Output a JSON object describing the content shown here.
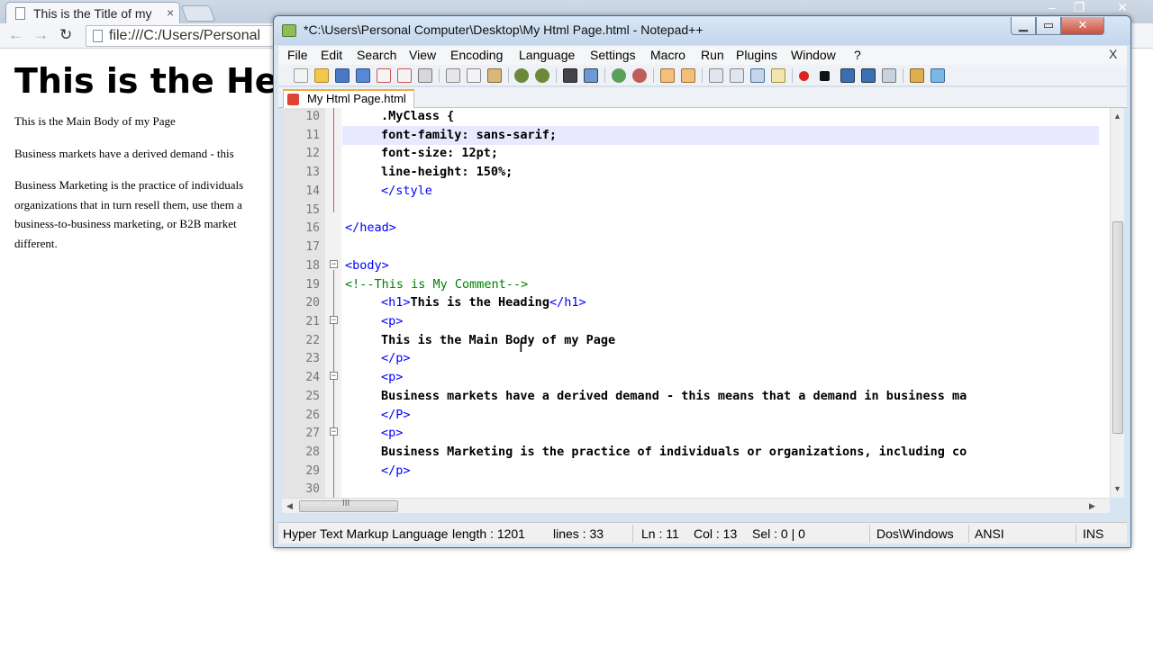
{
  "browser": {
    "tab_title": "This is the Title of my",
    "tab_close": "×",
    "url": "file:///C:/Users/Personal",
    "content": {
      "heading": "This is the He",
      "para1": "This is the Main Body of my Page",
      "para2": "Business markets have a derived demand - this",
      "para3_lines": [
        "Business Marketing is the practice of individuals",
        "organizations that in turn resell them, use them a",
        "business-to-business marketing, or B2B market",
        "different."
      ]
    }
  },
  "npp": {
    "title": "*C:\\Users\\Personal Computer\\Desktop\\My Html Page.html - Notepad++",
    "menu": [
      "File",
      "Edit",
      "Search",
      "View",
      "Encoding",
      "Language",
      "Settings",
      "Macro",
      "Run",
      "Plugins",
      "Window",
      "?"
    ],
    "menu_close": "X",
    "tab_label": "My Html Page.html",
    "editor": {
      "line_numbers": [
        "10",
        "11",
        "12",
        "13",
        "14",
        "15",
        "16",
        "17",
        "18",
        "19",
        "20",
        "21",
        "22",
        "23",
        "24",
        "25",
        "26",
        "27",
        "28",
        "29",
        "30"
      ],
      "lines": {
        "l10": ".MyClass {",
        "l11": "font-family: sans-sarif;",
        "l12": "font-size: 12pt;",
        "l13": "line-height: 150%;",
        "l14": "</style",
        "l16": "</head>",
        "l18": "<body>",
        "l19": "<!--This is My Comment-->",
        "l20_open": "<h1>",
        "l20_text": "This is the Heading",
        "l20_close": "</h1>",
        "l21": "<p>",
        "l22": "This is the Main Body of my Page",
        "l23": "</p>",
        "l24": "<p>",
        "l25": "Business markets have a derived demand - this means that a demand in business ma",
        "l26": "</P>",
        "l27": "<p>",
        "l28": "Business Marketing is the practice of individuals or organizations, including co",
        "l29": "</p>"
      }
    },
    "status": {
      "type": "Hyper Text Markup Language",
      "length": "length : 1201",
      "lines": "lines : 33",
      "ln": "Ln : 11",
      "col": "Col : 13",
      "sel": "Sel : 0 | 0",
      "eol": "Dos\\Windows",
      "encoding": "ANSI",
      "mode": "INS"
    }
  },
  "colors": {
    "tag": "#0000ff",
    "closing_tag_name": "#ff0000",
    "comment": "#008000",
    "current_line": "#e8e8ff"
  }
}
